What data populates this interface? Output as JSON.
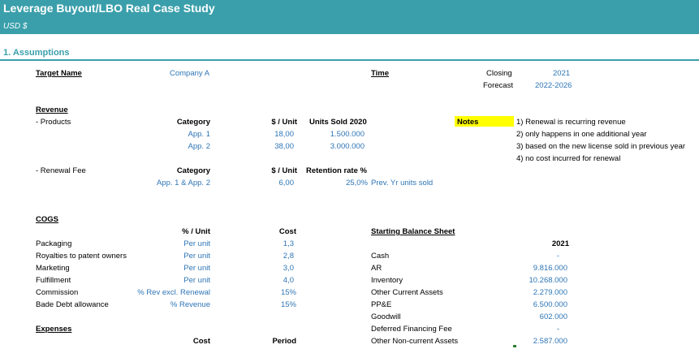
{
  "header": {
    "title": "Leverage Buyout/LBO Real Case Study",
    "currency": "USD $"
  },
  "section": {
    "title": "1. Assumptions"
  },
  "target": {
    "label": "Target Name",
    "value": "Company A"
  },
  "time": {
    "label": "Time",
    "closing_label": "Closing",
    "closing_value": "2021",
    "forecast_label": "Forecast",
    "forecast_value": "2022-2026"
  },
  "revenue": {
    "heading": "Revenue",
    "products_label": " - Products",
    "col_category": "Category",
    "col_per_unit": "$ / Unit",
    "col_units_sold": "Units Sold 2020",
    "products": [
      {
        "category": "App. 1",
        "per_unit": "18,00",
        "units": "1.500.000"
      },
      {
        "category": "App. 2",
        "per_unit": "38,00",
        "units": "3.000.000"
      }
    ],
    "renewal_label": " - Renewal Fee",
    "col_retention": "Retention rate %",
    "renewal": {
      "category": "App. 1 & App. 2",
      "per_unit": "6,00",
      "rate": "25,0%",
      "note": "Prev. Yr units sold"
    }
  },
  "notes": {
    "label": "Notes",
    "items": [
      "1) Renewal is recurring revenue",
      "2) only happens in one additional year",
      "3) based on the new license sold in previous year",
      "4) no cost incurred for renewal"
    ]
  },
  "cogs": {
    "heading": "COGS",
    "col_unit": "% / Unit",
    "col_cost": "Cost",
    "rows": [
      {
        "name": "Packaging",
        "unit": "Per unit",
        "cost": "1,3"
      },
      {
        "name": "Royalties to patent owners",
        "unit": "Per unit",
        "cost": "2,8"
      },
      {
        "name": "Marketing",
        "unit": "Per unit",
        "cost": "3,0"
      },
      {
        "name": "Fulfillment",
        "unit": "Per unit",
        "cost": "4,0"
      },
      {
        "name": "Commission",
        "unit": "% Rev excl. Renewal",
        "cost": "15%"
      },
      {
        "name": "Bade Debt allowance",
        "unit": "% Revenue",
        "cost": "15%"
      }
    ]
  },
  "balance": {
    "heading": "Starting Balance Sheet",
    "year": "2021",
    "rows": [
      {
        "name": "Cash",
        "value": "-"
      },
      {
        "name": "AR",
        "value": "9.816.000"
      },
      {
        "name": "Inventory",
        "value": "10.268.000"
      },
      {
        "name": "Other Current Assets",
        "value": "2.279.000"
      },
      {
        "name": "PP&E",
        "value": "6.500.000"
      },
      {
        "name": "Goodwill",
        "value": "602.000"
      },
      {
        "name": "Deferred Financing Fee",
        "value": "-"
      },
      {
        "name": "Other Non-current Assets",
        "value": "2.587.000"
      }
    ]
  },
  "expenses": {
    "heading": "Expenses",
    "col_cost": "Cost",
    "col_period": "Period"
  }
}
